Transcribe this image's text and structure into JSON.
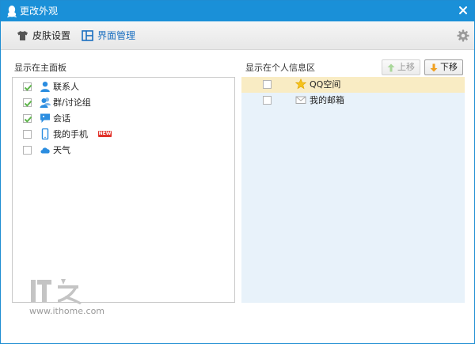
{
  "window": {
    "title": "更改外观",
    "close_icon": "close-icon",
    "accent": "#1a90d8"
  },
  "toolbar": {
    "tabs": [
      {
        "label": "皮肤设置",
        "icon": "tshirt-icon",
        "active": false
      },
      {
        "label": "界面管理",
        "icon": "layout-icon",
        "active": true
      }
    ],
    "settings_icon": "gear-icon"
  },
  "left_panel": {
    "label": "显示在主面板",
    "items": [
      {
        "label": "联系人",
        "checked": true,
        "icon": "contact-icon"
      },
      {
        "label": "群/讨论组",
        "checked": true,
        "icon": "group-icon"
      },
      {
        "label": "会话",
        "checked": true,
        "icon": "chat-icon"
      },
      {
        "label": "我的手机",
        "checked": false,
        "icon": "phone-icon",
        "badge": "NEW"
      },
      {
        "label": "天气",
        "checked": false,
        "icon": "cloud-icon"
      }
    ]
  },
  "right_panel": {
    "label": "显示在个人信息区",
    "buttons": {
      "up": "上移",
      "down": "下移"
    },
    "items": [
      {
        "label": "QQ空间",
        "checked": false,
        "icon": "star-icon",
        "selected": true
      },
      {
        "label": "我的邮箱",
        "checked": false,
        "icon": "mail-icon",
        "selected": false
      }
    ]
  },
  "watermark": {
    "logo_text": "IT之家",
    "url": "www.ithome.com"
  }
}
